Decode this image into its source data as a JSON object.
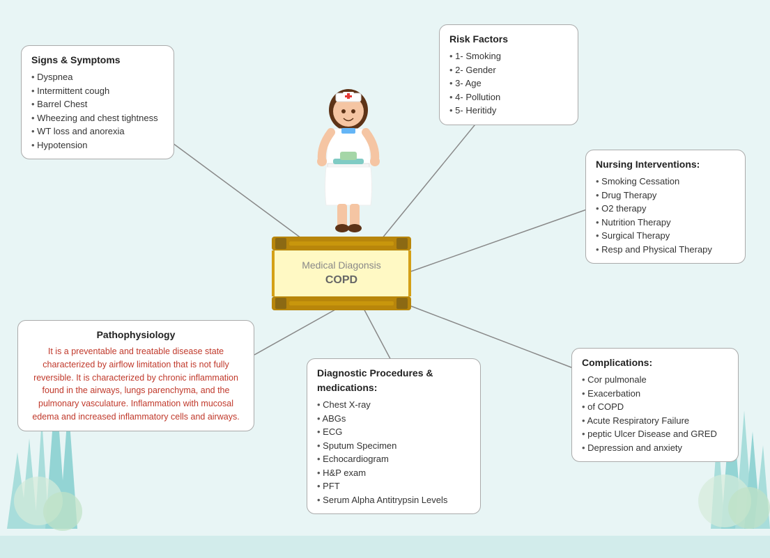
{
  "signs": {
    "title": "Signs & Symptoms",
    "items": [
      "Dyspnea",
      "Intermittent cough",
      "Barrel Chest",
      "Wheezing and chest tightness",
      "WT loss and anorexia",
      "Hypotension"
    ]
  },
  "risk": {
    "title": "Risk Factors",
    "items": [
      "1- Smoking",
      "2- Gender",
      "3- Age",
      "4- Pollution",
      "5- Heritidy"
    ]
  },
  "nursing": {
    "title": "Nursing Interventions:",
    "items": [
      "Smoking Cessation",
      "Drug Therapy",
      "O2 therapy",
      "Nutrition Therapy",
      "Surgical Therapy",
      "Resp and Physical Therapy"
    ]
  },
  "patho": {
    "title": "Pathophysiology",
    "text": "It is a preventable and treatable disease state characterized by airflow limitation that is not fully reversible. It is characterized by chronic inflammation found in the airways, lungs parenchyma, and the pulmonary vasculature. Inflammation with mucosal edema and increased inflammatory cells and airways."
  },
  "diag": {
    "title": "Diagnostic Procedures & medications:",
    "items": [
      "Chest X-ray",
      "ABGs",
      "ECG",
      "Sputum Specimen",
      "Echocardiogram",
      "H&P exam",
      "PFT",
      "Serum Alpha Antitrypsin Levels"
    ]
  },
  "comp": {
    "title": "Complications:",
    "items": [
      "Cor pulmonale",
      "Exacerbation",
      "of COPD",
      "Acute Respiratory Failure",
      "peptic Ulcer Disease and GRED",
      "Depression and anxiety"
    ]
  },
  "center": {
    "line1": "Medical Diagonsis",
    "line2": "COPD"
  }
}
